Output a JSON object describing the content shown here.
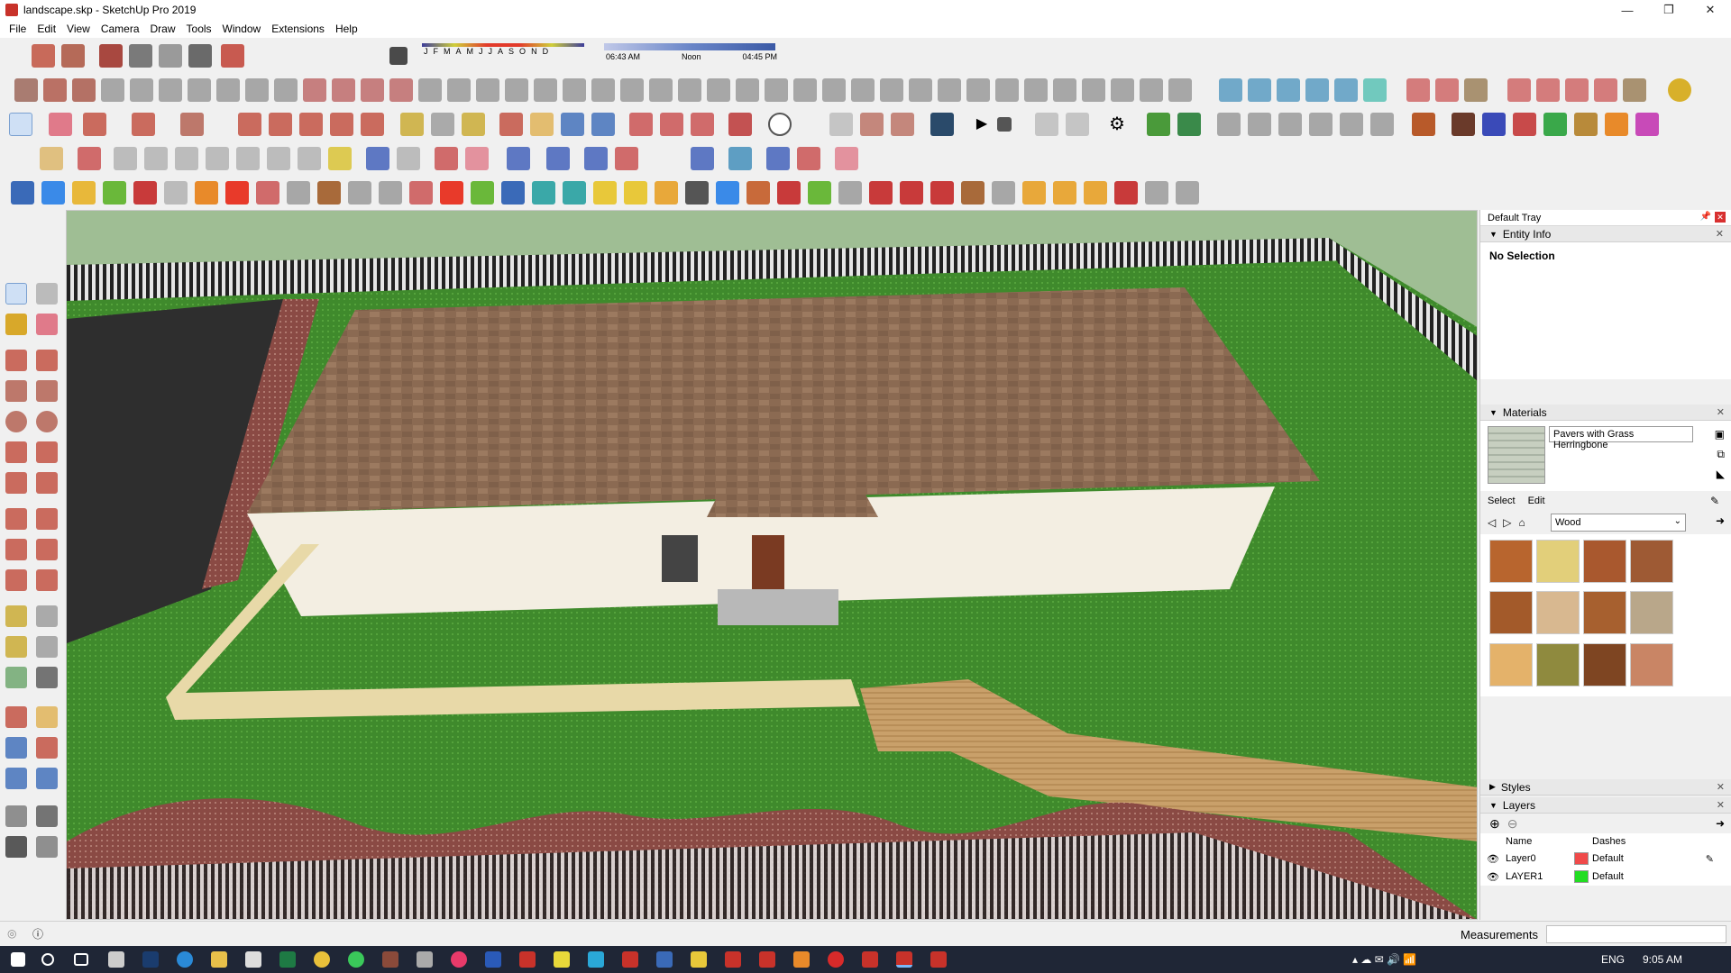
{
  "window": {
    "title": "landscape.skp - SketchUp Pro 2019",
    "minimize_icon": "—",
    "maximize_icon": "❐",
    "close_icon": "✕"
  },
  "menu": [
    "File",
    "Edit",
    "View",
    "Camera",
    "Draw",
    "Tools",
    "Window",
    "Extensions",
    "Help"
  ],
  "shadows": {
    "months": [
      "J",
      "F",
      "M",
      "A",
      "M",
      "J",
      "J",
      "A",
      "S",
      "O",
      "N",
      "D"
    ],
    "time_start": "06:43 AM",
    "time_mid": "Noon",
    "time_end": "04:45 PM"
  },
  "tray": {
    "title": "Default Tray",
    "entity_info": {
      "label": "Entity Info",
      "selection": "No Selection"
    },
    "materials": {
      "label": "Materials",
      "current_name": "Pavers with Grass Herringbone",
      "tab_select": "Select",
      "tab_edit": "Edit",
      "library": "Wood",
      "swatch_colors": [
        "#b8652e",
        "#e2cf7a",
        "#a9582e",
        "#9e5a34",
        "#a35a2a",
        "#d8b890",
        "#a7602f",
        "#b9a78a",
        "#e4b26a",
        "#8f8a3e",
        "#7e4522",
        "#c98565"
      ]
    },
    "styles": {
      "label": "Styles"
    },
    "layers": {
      "label": "Layers",
      "col_name": "Name",
      "col_dashes": "Dashes",
      "rows": [
        {
          "name": "Layer0",
          "color": "#f04a4a",
          "dashes": "Default"
        },
        {
          "name": "LAYER1",
          "color": "#22dd22",
          "dashes": "Default"
        }
      ]
    }
  },
  "status": {
    "measurements_label": "Measurements"
  },
  "taskbar": {
    "lang": "ENG",
    "time": "9:05 AM"
  }
}
